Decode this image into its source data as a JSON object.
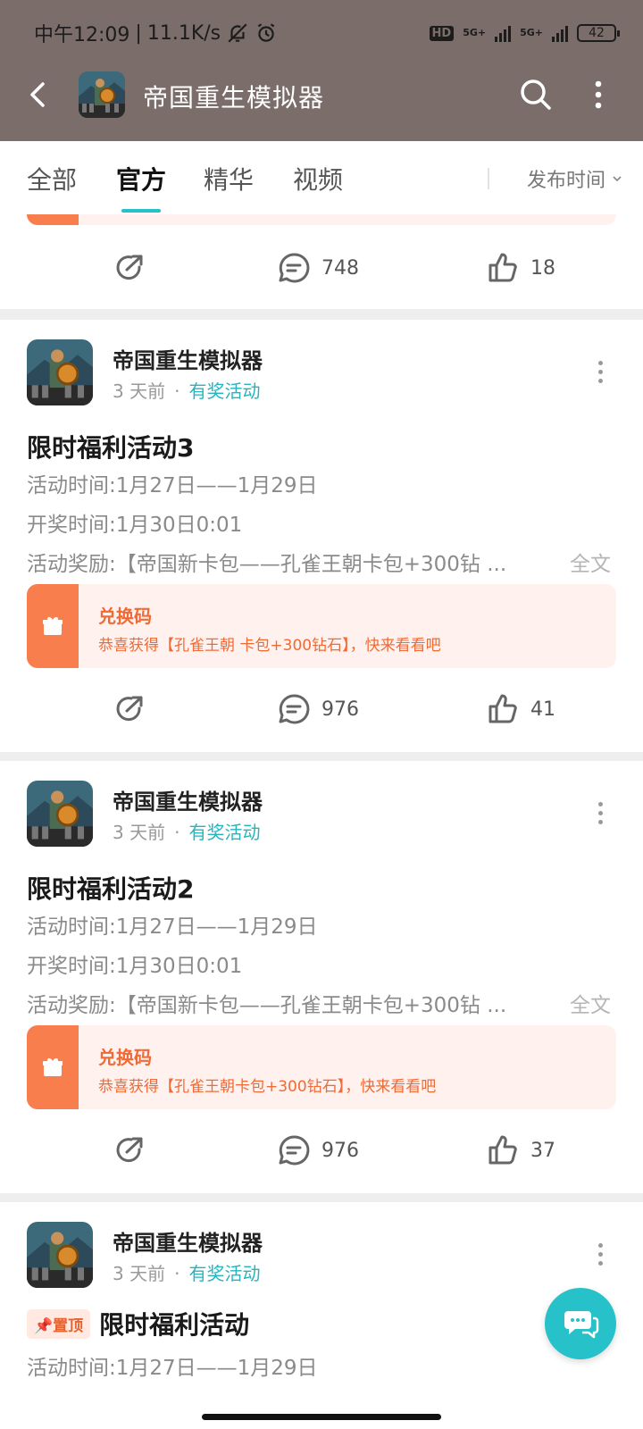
{
  "status_bar": {
    "time": "中午12:09",
    "speed": "11.1K/s",
    "hd": "HD",
    "network": "5G+",
    "battery": "42"
  },
  "header": {
    "title": "帝国重生模拟器"
  },
  "tabs": [
    {
      "label": "全部",
      "active": false
    },
    {
      "label": "官方",
      "active": true
    },
    {
      "label": "精华",
      "active": false
    },
    {
      "label": "视频",
      "active": false
    }
  ],
  "sort": {
    "label": "发布时间"
  },
  "top_partial": {
    "comments": "748",
    "likes": "18"
  },
  "posts": [
    {
      "author": "帝国重生模拟器",
      "time": "3 天前",
      "tag": "有奖活动",
      "title": "限时福利活动3",
      "lines": [
        "活动时间:1月27日——1月29日",
        "开奖时间:1月30日0:01",
        "活动奖励:【帝国新卡包——孔雀王朝卡包+300钻 ..."
      ],
      "full_text": "全文",
      "coupon_title": "兑换码",
      "coupon_desc": "恭喜获得【孔雀王朝 卡包+300钻石】，快来看看吧",
      "comments": "976",
      "likes": "41"
    },
    {
      "author": "帝国重生模拟器",
      "time": "3 天前",
      "tag": "有奖活动",
      "title": "限时福利活动2",
      "lines": [
        "活动时间:1月27日——1月29日",
        "开奖时间:1月30日0:01",
        "活动奖励:【帝国新卡包——孔雀王朝卡包+300钻 ..."
      ],
      "full_text": "全文",
      "coupon_title": "兑换码",
      "coupon_desc": "恭喜获得【孔雀王朝卡包+300钻石】，快来看看吧",
      "comments": "976",
      "likes": "37"
    },
    {
      "author": "帝国重生模拟器",
      "time": "3 天前",
      "tag": "有奖活动",
      "pin_label": "置顶",
      "title": "限时福利活动",
      "lines": [
        "活动时间:1月27日——1月29日"
      ]
    }
  ],
  "colors": {
    "accent": "#26c1c9",
    "header_bg": "#7a6d6a",
    "coupon_bg": "#fff1ed",
    "coupon_accent": "#f97e4e"
  }
}
